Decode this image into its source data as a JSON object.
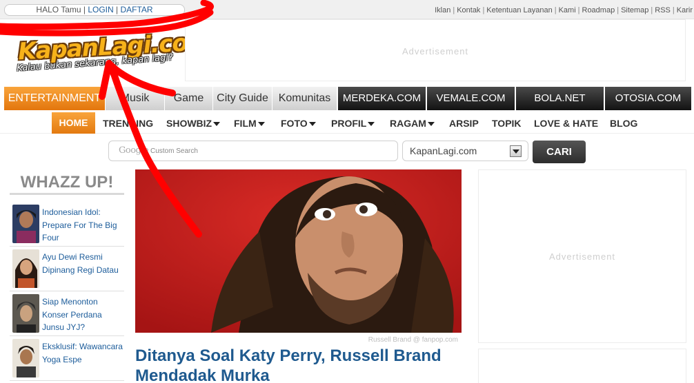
{
  "topbar": {
    "greeting": "HALO Tamu",
    "login_link": "LOGIN",
    "register_link": "DAFTAR",
    "links": [
      "Iklan",
      "Kontak",
      "Ketentuan Layanan",
      "Kami",
      "Roadmap",
      "Sitemap",
      "RSS",
      "Karir"
    ]
  },
  "logo": {
    "name": "KapanLagi.com",
    "tagline": "Kalau bukan sekarang, kapan lagi?"
  },
  "ads": {
    "label": "Advertisement"
  },
  "main_nav": {
    "items": [
      "ENTERTAINMENT",
      "Musik",
      "Game",
      "City Guide",
      "Komunitas"
    ],
    "network": [
      "MERDEKA.COM",
      "VEMALE.COM",
      "BOLA.NET",
      "OTOSIA.COM"
    ]
  },
  "sub_nav": {
    "home": "HOME",
    "items": [
      "TRENDING",
      "SHOWBIZ",
      "FILM",
      "FOTO",
      "PROFIL",
      "RAGAM",
      "ARSIP",
      "TOPIK",
      "LOVE & HATE",
      "BLOG"
    ]
  },
  "search": {
    "google_word": "Google",
    "placeholder": "Custom Search",
    "site_select": "KapanLagi.com",
    "button": "CARI"
  },
  "whazz_up": {
    "title": "WHAZZ UP!",
    "items": [
      {
        "title": "Indonesian Idol: Prepare For The Big Four"
      },
      {
        "title": "Ayu Dewi Resmi Dipinang Regi Datau"
      },
      {
        "title": "Siap Menonton Konser Perdana Junsu JYJ?"
      },
      {
        "title": "Eksklusif: Wawancara Yoga Espe"
      }
    ]
  },
  "featured": {
    "caption": "Russell Brand @ fanpop.com",
    "headline": "Ditanya Soal Katy Perry, Russell Brand Mendadak Murka"
  },
  "colors": {
    "brand_orange": "#f08a1c",
    "link_blue": "#1c5c9a",
    "headline_blue": "#1f5a8f",
    "annotation_red": "#ff0000"
  }
}
